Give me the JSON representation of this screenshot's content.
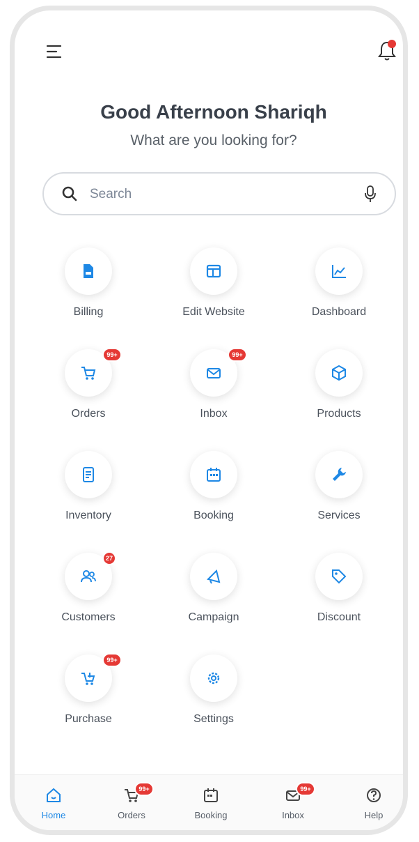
{
  "header": {
    "greeting": "Good Afternoon Shariqh",
    "subtitle": "What are you looking for?"
  },
  "search": {
    "placeholder": "Search",
    "value": ""
  },
  "grid": {
    "items": [
      {
        "label": "Billing",
        "icon": "billing-icon"
      },
      {
        "label": "Edit Website",
        "icon": "website-icon"
      },
      {
        "label": "Dashboard",
        "icon": "chart-icon"
      },
      {
        "label": "Orders",
        "icon": "cart-icon",
        "badge": "99+"
      },
      {
        "label": "Inbox",
        "icon": "mail-icon",
        "badge": "99+"
      },
      {
        "label": "Products",
        "icon": "box-icon"
      },
      {
        "label": "Inventory",
        "icon": "inventory-icon"
      },
      {
        "label": "Booking",
        "icon": "calendar-icon"
      },
      {
        "label": "Services",
        "icon": "wrench-icon"
      },
      {
        "label": "Customers",
        "icon": "users-icon",
        "badge": "27"
      },
      {
        "label": "Campaign",
        "icon": "megaphone-icon"
      },
      {
        "label": "Discount",
        "icon": "tag-icon"
      },
      {
        "label": "Purchase",
        "icon": "purchase-icon",
        "badge": "99+"
      },
      {
        "label": "Settings",
        "icon": "gear-icon"
      }
    ]
  },
  "nav": {
    "items": [
      {
        "label": "Home",
        "icon": "home-icon",
        "active": true
      },
      {
        "label": "Orders",
        "icon": "cart-icon",
        "badge": "99+"
      },
      {
        "label": "Booking",
        "icon": "calendar-icon"
      },
      {
        "label": "Inbox",
        "icon": "mail-icon",
        "badge": "99+"
      },
      {
        "label": "Help",
        "icon": "help-icon"
      }
    ]
  },
  "colors": {
    "accent": "#1e88e5",
    "badge": "#e53935",
    "text": "#39404a"
  }
}
